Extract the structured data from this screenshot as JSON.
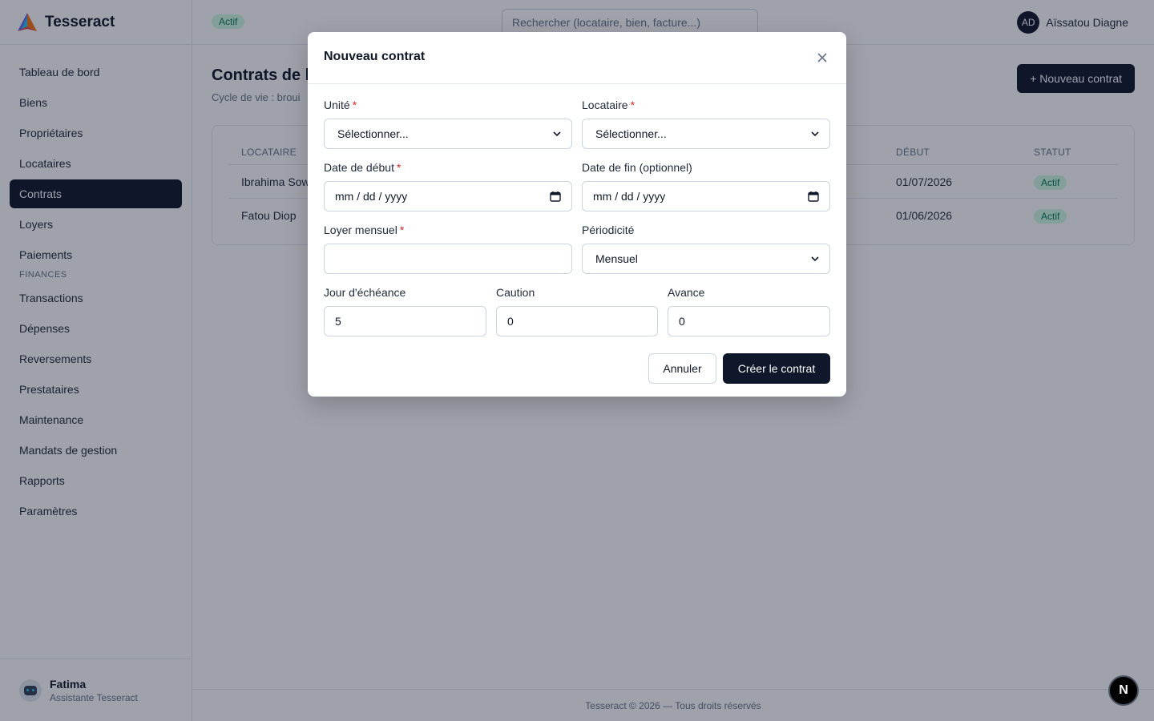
{
  "app": {
    "name": "Tesseract",
    "logo_icon": "tesseract-logo-icon"
  },
  "sidebar": {
    "items": [
      {
        "label": "Tableau de bord"
      },
      {
        "label": "Biens"
      },
      {
        "label": "Propriétaires"
      },
      {
        "label": "Locataires"
      },
      {
        "label": "Contrats",
        "active": true
      },
      {
        "label": "Loyers"
      },
      {
        "label": "Paiements"
      }
    ],
    "section_finances": "FINANCES",
    "finance_items": [
      {
        "label": "Transactions"
      },
      {
        "label": "Dépenses"
      },
      {
        "label": "Reversements"
      },
      {
        "label": "Prestataires"
      },
      {
        "label": "Maintenance"
      },
      {
        "label": "Mandats de gestion"
      },
      {
        "label": "Rapports"
      },
      {
        "label": "Paramètres"
      }
    ],
    "assistant": {
      "name": "Fatima",
      "role": "Assistante Tesseract"
    }
  },
  "topbar": {
    "status_badge": "Actif",
    "search_placeholder": "Rechercher (locataire, bien, facture...)",
    "user_initials": "AD",
    "user_name": "Aïssatou Diagne"
  },
  "main": {
    "title": "Contrats de l",
    "subtitle": "Cycle de vie : broui",
    "new_button": "+ Nouveau contrat",
    "table": {
      "headers": {
        "locataire": "LOCATAIRE",
        "debut": "DÉBUT",
        "statut": "STATUT"
      },
      "rows": [
        {
          "locataire": "Ibrahima Sow",
          "debut": "01/07/2026",
          "statut": "Actif"
        },
        {
          "locataire": "Fatou Diop",
          "debut": "01/06/2026",
          "statut": "Actif"
        }
      ]
    }
  },
  "footer": {
    "text": "Tesseract © 2026 — Tous droits réservés"
  },
  "dev_badge": "N",
  "modal": {
    "title": "Nouveau contrat",
    "close_icon": "close-icon",
    "fields": {
      "unite": {
        "label": "Unité",
        "value": "Sélectionner..."
      },
      "locataire": {
        "label": "Locataire",
        "value": "Sélectionner..."
      },
      "date_debut": {
        "label": "Date de début",
        "value": "mm / dd / yyyy"
      },
      "date_fin": {
        "label": "Date de fin (optionnel)",
        "value": "mm / dd / yyyy"
      },
      "loyer": {
        "label": "Loyer mensuel",
        "value": ""
      },
      "periodicite": {
        "label": "Périodicité",
        "value": "Mensuel"
      },
      "jour": {
        "label": "Jour d'échéance",
        "value": "5"
      },
      "caution": {
        "label": "Caution",
        "value": "0"
      },
      "avance": {
        "label": "Avance",
        "value": "0"
      }
    },
    "required_mark": "*",
    "cancel_label": "Annuler",
    "create_label": "Créer le contrat"
  },
  "colors": {
    "primary": "#0f172a",
    "success_bg": "#d1fae5",
    "success_text": "#047857",
    "required": "#dc2626"
  }
}
